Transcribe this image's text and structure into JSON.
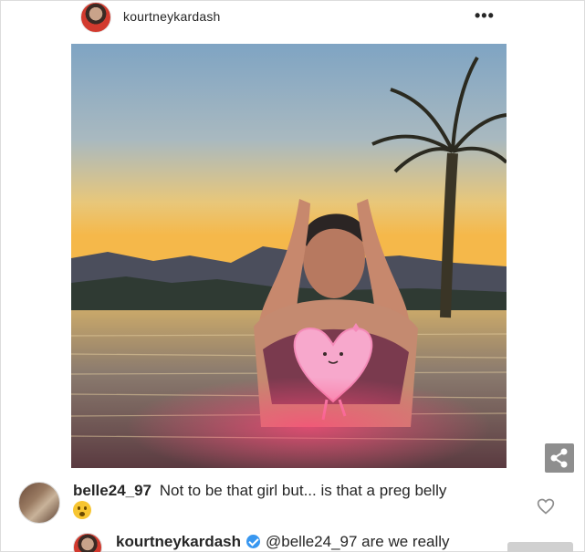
{
  "post": {
    "username": "kourtneykardash",
    "more_icon": "more-horizontal-icon",
    "more_label": "•••"
  },
  "photo": {
    "description_icon": "photo",
    "sticker": "heart-sticker"
  },
  "share": {
    "icon": "share-icon"
  },
  "comment": {
    "username": "belle24_97",
    "text": "Not to be that girl but... is that a preg belly",
    "emoji": "hushed-face-emoji",
    "like_icon": "heart-outline-icon"
  },
  "reply": {
    "username": "kourtneykardash",
    "verified_icon": "verified-badge-icon",
    "text": "@belle24_97 are we really"
  },
  "colors": {
    "text": "#262626",
    "verified": "#3897f0",
    "share_bg": "#8e8e8e"
  }
}
